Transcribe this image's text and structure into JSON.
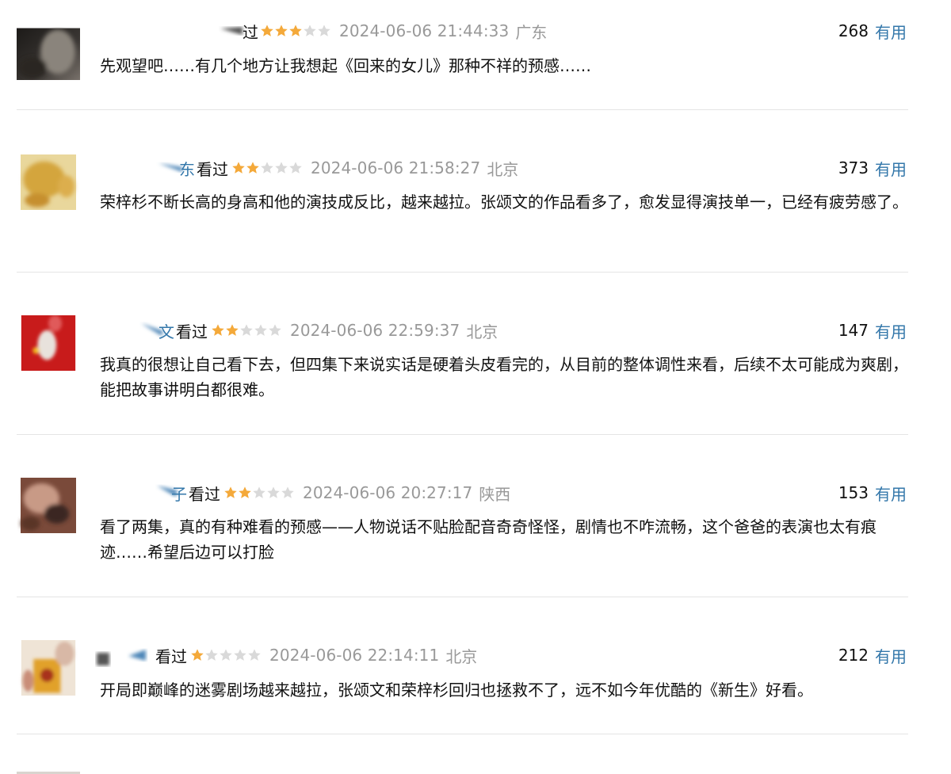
{
  "colors": {
    "link": "#3377aa",
    "star_on": "#f4a93a",
    "star_off": "#d9d9d9",
    "meta_gray": "#999999",
    "divider": "#e4e4e4"
  },
  "reviews": [
    {
      "user_visible": "过",
      "watched_label": "",
      "rating": 3,
      "time": "2024-06-06 21:44:33",
      "location": "广东",
      "votes": "268",
      "vote_label": "有用",
      "content": "先观望吧……有几个地方让我想起《回来的女儿》那种不祥的预感……",
      "avatar_icon": "blurred-avatar-dark"
    },
    {
      "user_visible": "东",
      "watched_label": "看过",
      "rating": 2,
      "time": "2024-06-06 21:58:27",
      "location": "北京",
      "votes": "373",
      "vote_label": "有用",
      "content": "荣梓杉不断长高的身高和他的演技成反比，越来越拉。张颂文的作品看多了，愈发显得演技单一，已经有疲劳感了。",
      "avatar_icon": "blurred-avatar-yellow"
    },
    {
      "user_visible": "文",
      "watched_label": "看过",
      "rating": 2,
      "time": "2024-06-06 22:59:37",
      "location": "北京",
      "votes": "147",
      "vote_label": "有用",
      "content": "我真的很想让自己看下去，但四集下来说实话是硬着头皮看完的，从目前的整体调性来看，后续不太可能成为爽剧，能把故事讲明白都很难。",
      "avatar_icon": "blurred-avatar-red"
    },
    {
      "user_visible": "子",
      "watched_label": "看过",
      "rating": 2,
      "time": "2024-06-06 20:27:17",
      "location": "陕西",
      "votes": "153",
      "vote_label": "有用",
      "content": "看了两集，真的有种难看的预感——人物说话不贴脸配音奇奇怪怪，剧情也不咋流畅，这个爸爸的表演也太有痕迹……希望后边可以打脸",
      "avatar_icon": "blurred-avatar-brown"
    },
    {
      "user_visible": "",
      "watched_label": "看过",
      "rating": 1,
      "time": "2024-06-06 22:14:11",
      "location": "北京",
      "votes": "212",
      "vote_label": "有用",
      "content": "开局即巅峰的迷雾剧场越来越拉，张颂文和荣梓杉回归也拯救不了，远不如今年优酷的《新生》好看。",
      "avatar_icon": "blurred-avatar-book"
    }
  ]
}
